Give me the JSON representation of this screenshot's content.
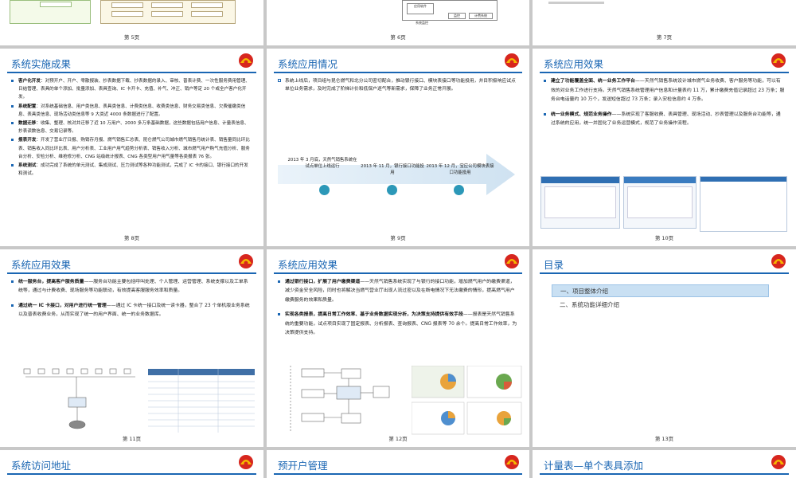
{
  "slides": {
    "s5": {
      "page": "第 5页"
    },
    "s6": {
      "page": "第 6页",
      "labels": [
        "应用软件",
        "系统监控",
        "监控",
        "计费系统"
      ]
    },
    "s7": {
      "page": "第 7页"
    },
    "s8": {
      "title": "系统实施成果",
      "page": "第 8页",
      "items": [
        {
          "head": "客户化开发",
          "text": "：对预开户、开户、零散报装、抄表数据下载、抄表数据的录入、审核、普表计费、一次性服务费用管理、日结管理、表具的单个添加、批量添加、表具查询、IC 卡开卡、充值、补气、冲正、销户等定 20 个或全户客户化开发。"
        },
        {
          "head": "系统配置",
          "text": "：对系统基础信息、用户类信息、表具类信息、计费类信息、收费类信息、财务交易类信息、欠费催缴类信息、表具类信息、现场活动类信息等 9 大类近 4000 条数据进行了配置。"
        },
        {
          "head": "数据迁移",
          "text": "：收集、整理、核对并迁移了近 10 万用户、2000 多万条基础数据，这些数据包括用户信息、计量表信息、抄表读数信息、交易记录等。"
        },
        {
          "head": "报表开发",
          "text": "：开发了营业厅日报、购销存月报、燃气销售汇总表、昆仑燃气公司城市燃气销售月统计表、销售量同比环比表、销售收入同比环比表、用户分析表、工业用户用气趋势分析表、销售收入分析、城市燃气用户购气充值分析、服务台分析、安检分析、维抢修分析、CNG 站级统计报表、CNG 各类型用户用气量等各类报表 76 张。"
        },
        {
          "head": "系统测试",
          "text": "：成功完成了系统的单元测试、集成测试、压力测试等各种功能测试，完成了 IC 卡的接口、银行接口的开发和测试。"
        }
      ]
    },
    "s9": {
      "title": "系统应用情况",
      "page": "第 9页",
      "intro": "系统上线后，项目组与昆仑燃气和北分公司密切配合，推动银行接口、模块表接口等功能投用，并目积极响应试点单位业务需求，及时完成了阶梯计价和低保户逐气等新需求，保障了业务正常开展。",
      "timeline": [
        {
          "label": "2013 年 3 月底，天然气销售系统在试点单位上线运行"
        },
        {
          "label": "2013 年 11 月，银行接口功能投用"
        },
        {
          "label": "2013 年 12 月，宝应公司模块表接口功能投用"
        }
      ]
    },
    "s10": {
      "title": "系统应用效果",
      "page": "第 10页",
      "items": [
        {
          "head": "建立了功能覆盖全面、统一业务工作平台",
          "text": "——天然气销售系统设计城市燃气业务收费、客户服务等功能，可以有效的对业务工作进行支持。天然气销售系统管理用户信息和计量表约 11 万，累计缴费充值记录超过 23 万条；服务台电话量约 10 万个，发送短信超过 73 万条；录入安检信息约 4 万条。"
        },
        {
          "head": "统一业务模式、规范业务操作",
          "text": "——系统实现了客服收费、表具管理、现场活动、抄表管理以及服务台功能等，通过系统的应用，统一并固化了业务运营模式，规范了业务操作流程。"
        }
      ]
    },
    "s11": {
      "title": "系统应用效果",
      "page": "第 11页",
      "items": [
        {
          "head": "统一服务台，提高客户服务质量",
          "text": "——服务台功能主要包括呼叫处理、个人管理、运营管理、系统支撑以及工单系统等，通过与计费收费、现场服务等功能联动，有效提高客服服务效率和质量。"
        },
        {
          "head": "通过统一 IC 卡接口，对用户进行统一管理",
          "text": "——通过 IC 卡统一接口及统一读卡器，整合了 23 个单机版业务系统以及普表收费业务，从而实现了统一的用户界面、统一的业务数据库。"
        }
      ]
    },
    "s12": {
      "title": "系统应用效果",
      "page": "第 12页",
      "items": [
        {
          "head": "通过银行接口，扩展了用户缴费渠道",
          "text": "——天然气销售系统实现了与银行的接口功能，增加燃气用户的缴费渠道，减少资金安全风险，同时也将解决当燃气营业厅出现人流过密以及在断电情况下无法缴费的情形，提高燃气用户缴费服务的效果和质量。"
        },
        {
          "head": "实现各类报表，提高日常工作效率、基于业务数据实现分析，为决策支持提供有效手段",
          "text": "——报表是天然气销售系统的重要功能，试点项目实现了固定报表、分析报表、查询报表、CNG 报表等 70 余个。提高日常工作效率，为决策提供支持。"
        }
      ]
    },
    "s13": {
      "title": "目录",
      "page": "第 13页",
      "toc": [
        "一、项目整体介绍",
        "二、系统功能详细介绍"
      ]
    },
    "s14": {
      "title": "系统访问地址"
    },
    "s15": {
      "title": "预开户管理"
    },
    "s16": {
      "title": "计量表—单个表具添加"
    }
  },
  "colors": {
    "accent": "#1a66b3",
    "timeline_dot": "#2c98b8",
    "toc_active": "#c9e0f3",
    "logo_red": "#d7261e",
    "logo_yellow": "#f5b700"
  }
}
